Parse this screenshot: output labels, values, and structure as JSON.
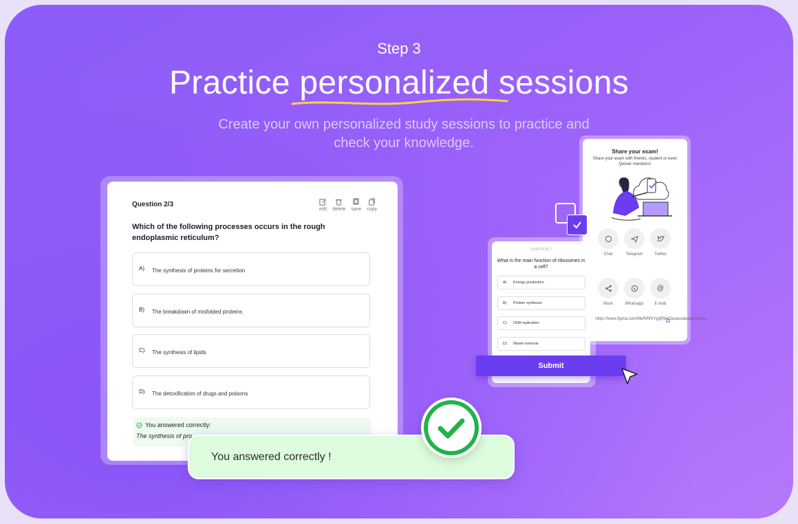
{
  "header": {
    "step": "Step 3",
    "headline_start": "Practice",
    "headline_highlight": "personalized",
    "headline_end": "sessions",
    "subtitle_line1": "Create your own personalized study sessions to practice and",
    "subtitle_line2": "check your knowledge."
  },
  "question_card": {
    "number": "Question 2/3",
    "tools": [
      "edit",
      "delete",
      "save",
      "copy"
    ],
    "question": "Which of the following processes occurs in the rough endoplasmic reticulum?",
    "options": [
      {
        "letter": "A)",
        "text": "The synthesis of proteins for secretion"
      },
      {
        "letter": "B)",
        "text": "The breakdown of misfolded proteins"
      },
      {
        "letter": "C)",
        "text": "The synthesis of lipids"
      },
      {
        "letter": "D)",
        "text": "The detoxification of drugs and poisons"
      }
    ],
    "feedback_title": "You answered correctly:",
    "feedback_answer": "The synthesis of pro"
  },
  "toast": {
    "text": "You answered correctly !"
  },
  "share_card": {
    "title": "Share your exam!",
    "subtitle": "Share your exam with friends, student or even Qwiser members!",
    "buttons": [
      "Chat",
      "Telegram",
      "Twitter",
      "More",
      "Whatsapp",
      "E-mail"
    ],
    "link": "https://www.figma.com/file/NfVhYygR9AOasassdaada/Share..."
  },
  "mini_quiz": {
    "label": "QUESTION 2",
    "question": "What is the main function of ribosomes in a cell?",
    "options": [
      {
        "letter": "A)",
        "text": "Energy production"
      },
      {
        "letter": "B)",
        "text": "Protein synthesis"
      },
      {
        "letter": "C)",
        "text": "DNA replication"
      },
      {
        "letter": "D)",
        "text": "Waste removal"
      }
    ],
    "submit": "Submit"
  },
  "colors": {
    "accent": "#6b3df0",
    "success": "#22b24c",
    "toast_bg": "#ddfbdd"
  }
}
